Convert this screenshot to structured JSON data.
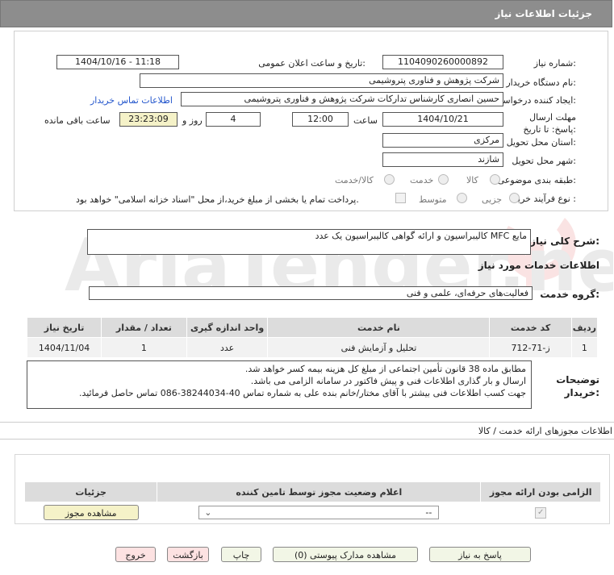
{
  "header": {
    "title": "جزئیات اطلاعات نیاز"
  },
  "form": {
    "need_number_label": "شماره نیاز:",
    "need_number": "1104090260000892",
    "announce_label": "تاریخ و ساعت اعلان عمومی:",
    "announce_value": "1404/10/16 - 11:18",
    "buyer_org_label": "نام دستگاه خریدار:",
    "buyer_org": "شرکت پژوهش و فناوری پتروشیمی",
    "creator_label": "ایجاد کننده درخواست:",
    "creator": "حسین انصاری کارشناس تدارکات شرکت پژوهش و فناوری پتروشیمی",
    "contact_link": "اطلاعات تماس خریدار",
    "deadline_label": "مهلت ارسال پاسخ: تا تاریخ:",
    "deadline_date": "1404/10/21",
    "time_label": "ساعت",
    "deadline_time": "12:00",
    "days_value": "4",
    "days_label": "روز و",
    "remaining_time": "23:23:09",
    "remaining_label": "ساعت باقی مانده",
    "province_label": "استان محل تحویل:",
    "province": "مرکزی",
    "city_label": "شهر محل تحویل:",
    "city": "شازند",
    "category_label": "طبقه بندی موضوعی:",
    "category_options": [
      "کالا",
      "خدمت",
      "کالا/خدمت"
    ],
    "process_label": "نوع فرآیند خرید :",
    "process_options": [
      "جزیی",
      "متوسط"
    ],
    "payment_note": "پرداخت تمام یا بخشی از مبلغ خرید،از محل \"اسناد خزانه اسلامی\" خواهد بود."
  },
  "description": {
    "label": "شرح کلی نیاز:",
    "text": "کالیبراسیون و ارائه گواهی کالیبراسیون یک عدد MFC مایع"
  },
  "services_info": {
    "title": "اطلاعات خدمات مورد نیاز"
  },
  "service_group": {
    "label": "گروه خدمت:",
    "value": "فعالیت‌های حرفه‌ای، علمی و فنی"
  },
  "table": {
    "headers": [
      "ردیف",
      "کد خدمت",
      "نام خدمت",
      "واحد اندازه گیری",
      "تعداد / مقدار",
      "تاریخ نیاز"
    ],
    "rows": [
      [
        "1",
        "ز-71-712",
        "تحلیل و آزمایش فنی",
        "عدد",
        "1",
        "1404/11/04"
      ]
    ]
  },
  "buyer_notes": {
    "label": "توضیحات خریدار:",
    "lines": [
      "مطابق ماده 38 قانون تأمین اجتماعی از مبلغ کل هزینه بیمه کسر خواهد شد.",
      "ارسال و بار گذاری اطلاعات فنی و پیش فاکتور در سامانه الزامی می باشد.",
      "جهت کسب اطلاعات فنی بیشتر با آقای مختار/خانم بنده علی به شماره تماس  40-38244034-086 تماس حاصل فرمائید."
    ]
  },
  "permits": {
    "title": "اطلاعات مجوزهای ارائه خدمت / کالا",
    "headers": [
      "الزامی بودن ارائه مجوز",
      "اعلام وضعیت مجوز توسط تامین کننده",
      "جزئیات"
    ],
    "select_value": "--",
    "view_button": "مشاهده مجوز"
  },
  "buttons": {
    "reply": "پاسخ به نیاز",
    "view_docs": "مشاهده مدارک پیوستی (0)",
    "print": "چاپ",
    "back": "بازگشت",
    "exit": "خروج"
  },
  "watermark": {
    "text": "AriaTender.net"
  },
  "colors": {
    "header_bg": "#8d8d8d",
    "link": "#2255cc",
    "yellow_box": "#f5f2c8",
    "watermark": "#d33"
  }
}
